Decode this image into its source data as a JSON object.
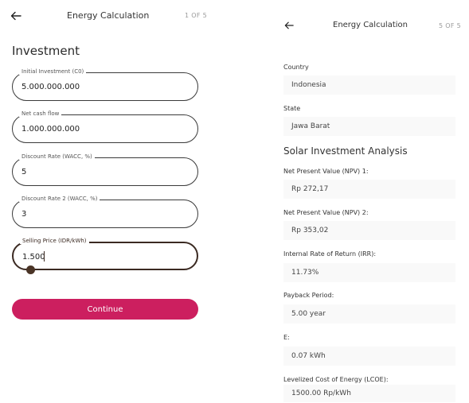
{
  "left": {
    "header": {
      "title": "Energy Calculation",
      "step": "1 OF 5"
    },
    "section_title": "Investment",
    "fields": [
      {
        "label": "Initial Investment (C0)",
        "value": "5.000.000.000"
      },
      {
        "label": "Net cash flow",
        "value": "1.000.000.000"
      },
      {
        "label": "Discount Rate (WACC, %)",
        "value": "5"
      },
      {
        "label": "Discount Rate 2 (WACC, %)",
        "value": "3"
      },
      {
        "label": "Selling Price (IDR/kWh)",
        "value": "1.500"
      }
    ],
    "continue_label": "Continue"
  },
  "right": {
    "header": {
      "title": "Energy Calculation",
      "step": "5 OF 5"
    },
    "country": {
      "label": "Country",
      "value": "Indonesia"
    },
    "state": {
      "label": "State",
      "value": "Jawa Barat"
    },
    "section_title": "Solar Investment Analysis",
    "results": [
      {
        "label": "Net Present Value (NPV) 1:",
        "value": "Rp 272,17"
      },
      {
        "label": "Net Present Value (NPV) 2:",
        "value": "Rp 353,02"
      },
      {
        "label": "Internal Rate of Return (IRR):",
        "value": "11.73%"
      },
      {
        "label": "Payback Period:",
        "value": "5.00 year"
      },
      {
        "label": "E:",
        "value": "0.07 kWh"
      },
      {
        "label": "Levelized Cost of Energy (LCOE):",
        "value": "1500.00 Rp/kWh"
      }
    ]
  },
  "colors": {
    "accent": "#cc1f5f",
    "focus": "#3b2a22"
  },
  "icons": {
    "back": "arrow-left-icon"
  }
}
